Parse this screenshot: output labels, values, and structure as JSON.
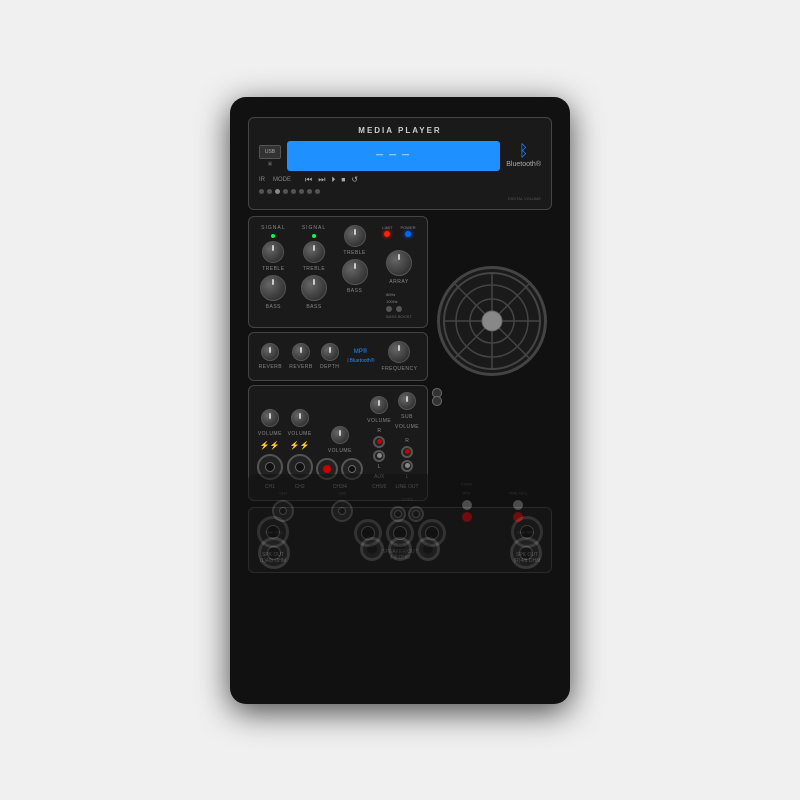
{
  "device": {
    "title": "MEDIA PLAYER",
    "bluetooth_text": "Bluetooth®",
    "usb_label": "USB",
    "ir_label": "IR",
    "mode_label": "MODE",
    "lcd_display": "",
    "channels": [
      "CH1",
      "CH2",
      "CH3/4",
      "CH5/6"
    ],
    "labels": {
      "treble": "TREBLE",
      "bass": "BASS",
      "signal": "SIGNAL",
      "limit": "LIMIT",
      "power": "POWER",
      "array": "ARRAY",
      "reverb": "REVERB",
      "depth": "DEPTH",
      "volume": "VOLUME",
      "frequency": "FREQUENCY",
      "sub_volume": "SUB VOLUME",
      "aux": "AUX",
      "line_out": "LINE OUT",
      "bass_boost": "BASS BOOST",
      "mp_bluetooth": "MP Bluetooth®",
      "80hz": "80Hz",
      "100hz": "100Hz",
      "spk_out_l": "SPK OUT\n(L)4/8 OHM",
      "spk_out_r": "SPK OUT\n(R)4/8 OHM",
      "speaker_out_center": "SPEAKER OUT\n4-8 OHM\n4-8 OHM\nSPEAKER OUT"
    }
  }
}
